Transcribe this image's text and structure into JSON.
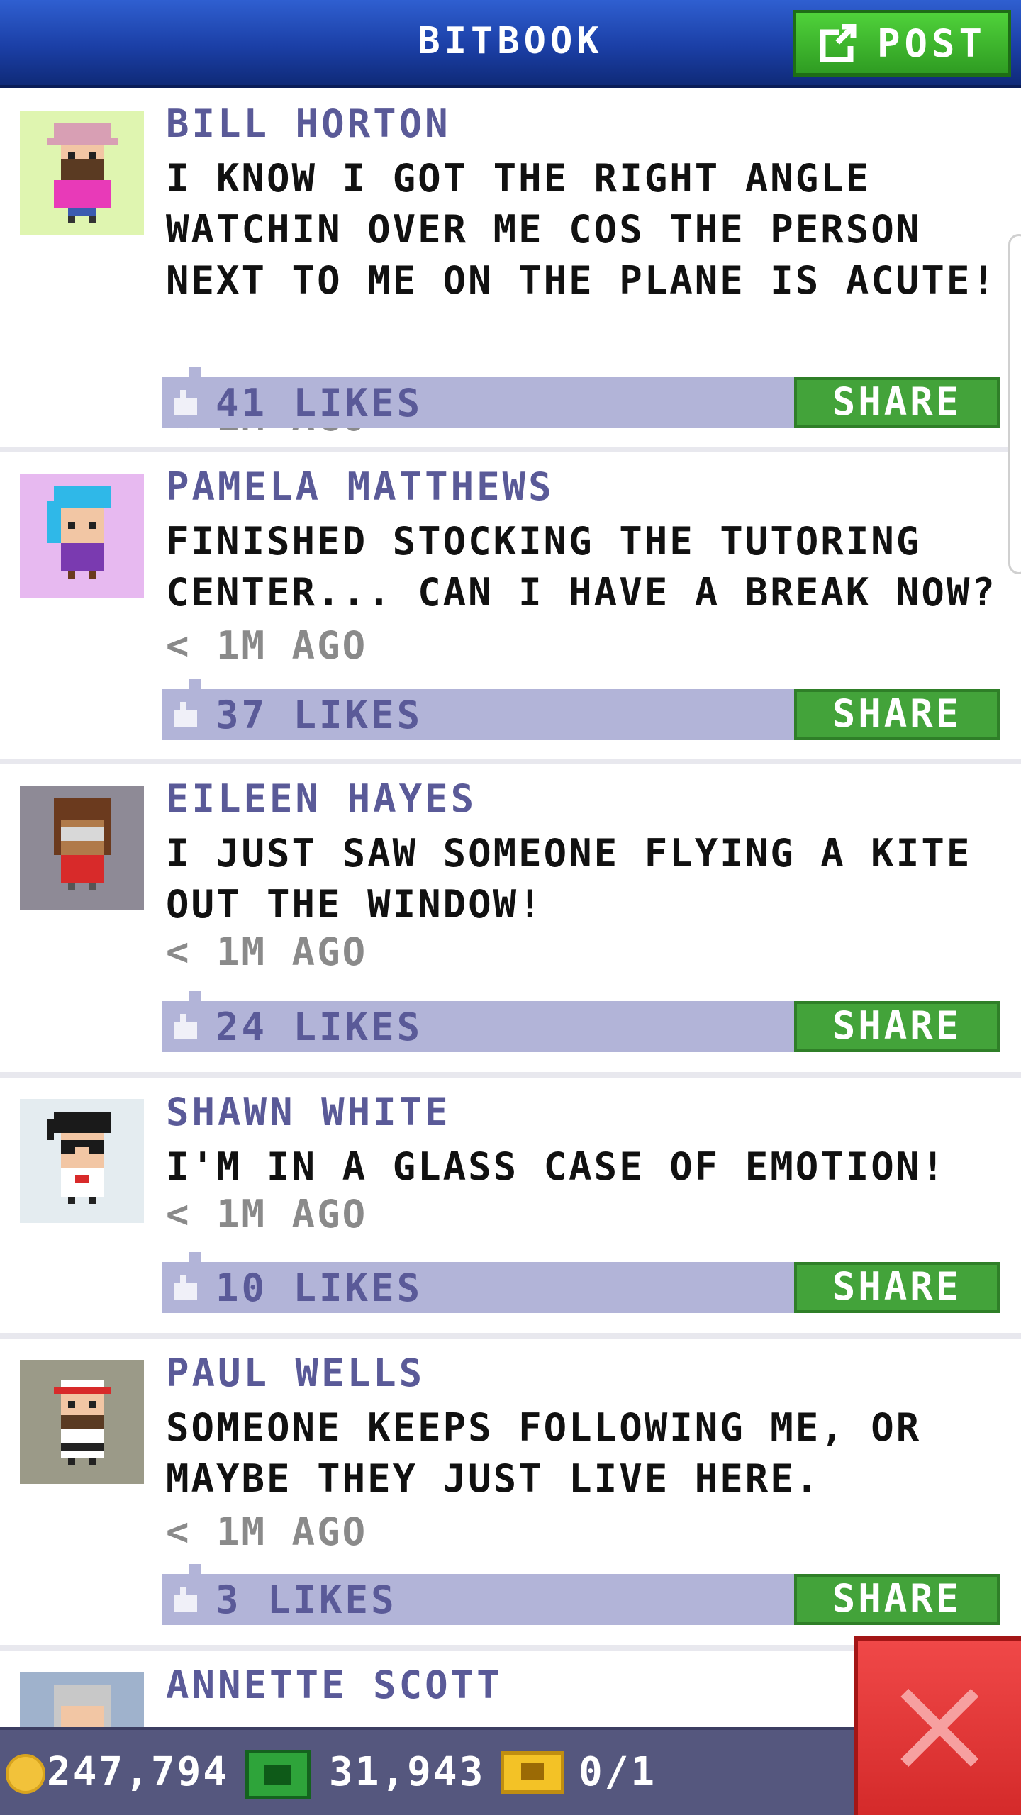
{
  "header": {
    "title": "BITBOOK",
    "post_label": "POST"
  },
  "posts": [
    {
      "name": "BILL HORTON",
      "text": "I KNOW I GOT THE RIGHT ANGLE WATCHIN OVER ME COS THE PERSON NEXT TO ME ON THE PLANE IS ACUTE!",
      "time": "< 1M AGO",
      "likes": "41 LIKES",
      "share": "SHARE",
      "avatar_bg": "#dff5b0"
    },
    {
      "name": "PAMELA MATTHEWS",
      "text": "FINISHED STOCKING THE TUTORING CENTER... CAN I HAVE A BREAK NOW?",
      "time": "< 1M AGO",
      "likes": "37 LIKES",
      "share": "SHARE",
      "avatar_bg": "#e7b9f0"
    },
    {
      "name": "EILEEN HAYES",
      "text": "I JUST SAW SOMEONE FLYING A KITE OUT THE WINDOW!",
      "time": "< 1M AGO",
      "likes": "24 LIKES",
      "share": "SHARE",
      "avatar_bg": "#8e8a96"
    },
    {
      "name": "SHAWN WHITE",
      "text": "I'M IN A GLASS CASE OF EMOTION!",
      "time": "< 1M AGO",
      "likes": "10 LIKES",
      "share": "SHARE",
      "avatar_bg": "#e4ecf0"
    },
    {
      "name": "PAUL WELLS",
      "text": "SOMEONE KEEPS FOLLOWING ME, OR MAYBE THEY JUST LIVE HERE.",
      "time": "< 1M AGO",
      "likes": "3 LIKES",
      "share": "SHARE",
      "avatar_bg": "#9b9a88"
    },
    {
      "name": "ANNETTE SCOTT",
      "avatar_bg": "#9fb2cc"
    }
  ],
  "bottom_bar": {
    "coins": "247,794",
    "bux": "31,943",
    "tickets": "0/1"
  },
  "colors": {
    "header_blue": "#1b3fa6",
    "share_green": "#43a33a",
    "likes_bar": "#b2b4d8",
    "name_purple": "#5a5a98",
    "close_red": "#d42a2a"
  },
  "icons": [
    "edit-icon",
    "like-icon",
    "coin-icon",
    "cash-icon",
    "ticket-icon",
    "close-icon"
  ]
}
